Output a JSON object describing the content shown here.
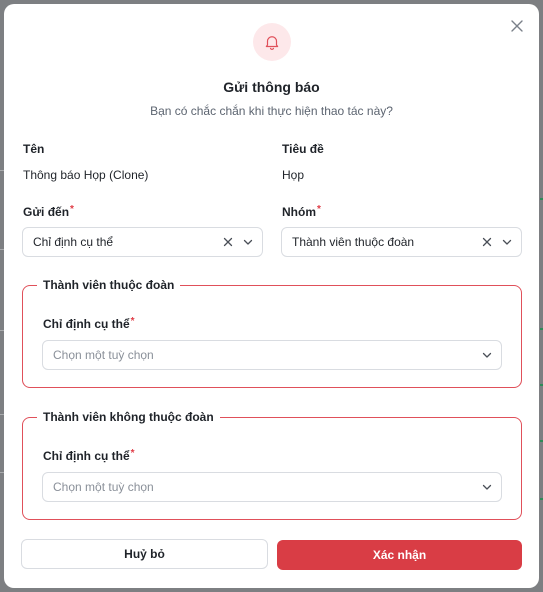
{
  "dialog": {
    "title": "Gửi thông báo",
    "subtitle": "Bạn có chắc chắn khi thực hiện thao tác này?",
    "icon": "bell-icon",
    "close_icon": "close-icon"
  },
  "fields": {
    "name_label": "Tên",
    "name_value": "Thông báo Họp (Clone)",
    "subject_label": "Tiêu đề",
    "subject_value": "Họp",
    "send_to_label": "Gửi đến",
    "send_to_value": "Chỉ định cụ thể",
    "group_label": "Nhóm",
    "group_value": "Thành viên thuộc đoàn",
    "required_mark": "*"
  },
  "members_in": {
    "legend": "Thành viên thuộc đoàn",
    "label": "Chỉ định cụ thể",
    "placeholder": "Chọn một tuỳ chọn"
  },
  "members_out": {
    "legend": "Thành viên không thuộc đoàn",
    "label": "Chỉ định cụ thể",
    "placeholder": "Chọn một tuỳ chọn"
  },
  "footer": {
    "cancel_label": "Huỷ bỏ",
    "confirm_label": "Xác nhận"
  },
  "colors": {
    "accent": "#d93d45",
    "group_border": "#e0505a",
    "icon_bg": "#fde8ea"
  }
}
